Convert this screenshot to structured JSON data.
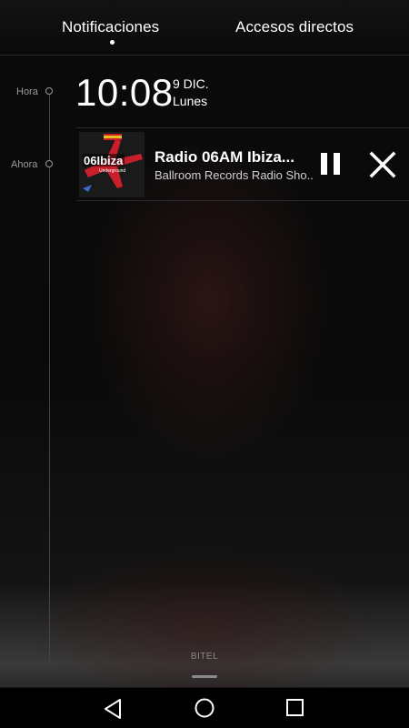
{
  "tabs": [
    {
      "label": "Notificaciones",
      "active": true
    },
    {
      "label": "Accesos directos",
      "active": false
    }
  ],
  "timeline": {
    "hora_label": "Hora",
    "ahora_label": "Ahora"
  },
  "clock": {
    "time": "10:08",
    "date": "9 DIC.",
    "weekday": "Lunes"
  },
  "notification": {
    "title": "Radio 06AM Ibiza...",
    "subtitle": "Ballroom Records Radio Sho..",
    "art_text": "06Ibiza",
    "art_subtext": "Underground",
    "pause_icon": "pause-icon",
    "close_icon": "close-icon"
  },
  "footer": {
    "carrier": "BITEL"
  },
  "navbar": {
    "back_icon": "back-icon",
    "home_icon": "home-icon",
    "recent_icon": "recent-apps-icon"
  },
  "colors": {
    "accent_red": "#c8202a",
    "text_primary": "#ffffff",
    "text_secondary": "#9a9a9a"
  }
}
